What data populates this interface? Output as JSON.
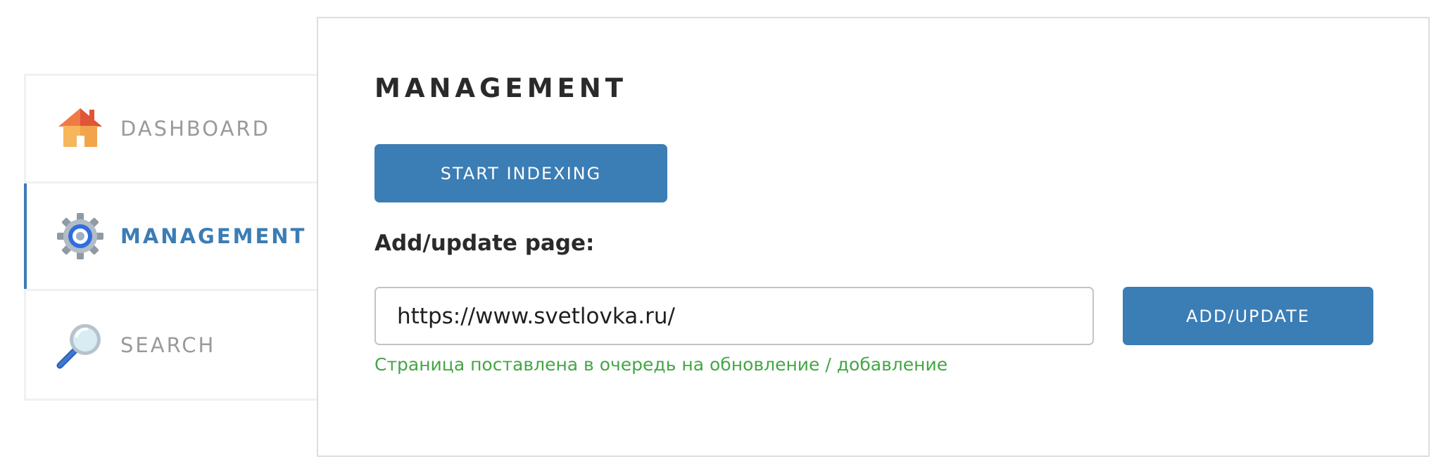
{
  "sidebar": {
    "items": [
      {
        "label": "DASHBOARD",
        "icon": "house-icon",
        "active": false
      },
      {
        "label": "MANAGEMENT",
        "icon": "gear-icon",
        "active": true
      },
      {
        "label": "SEARCH",
        "icon": "magnifier-icon",
        "active": false
      }
    ]
  },
  "main": {
    "title": "MANAGEMENT",
    "start_indexing_label": "START INDEXING",
    "add_update_section_label": "Add/update page:",
    "url_input_value": "https://www.svetlovka.ru/",
    "add_update_button_label": "ADD/UPDATE",
    "status_message": "Страница поставлена в очередь на обновление / добавление"
  },
  "colors": {
    "accent": "#3b7db5",
    "success": "#44a645",
    "inactive_text": "#9a9a9a",
    "heading_text": "#2a2a2a"
  }
}
